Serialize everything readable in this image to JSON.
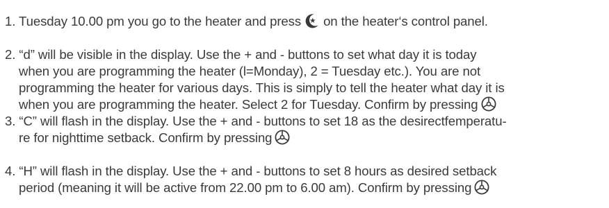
{
  "steps": [
    {
      "number": "1.",
      "lines": [
        {
          "before": "Tuesday 10.00 pm you go to the heater and press",
          "after": "on the heater‘s control panel."
        }
      ],
      "icon": "moon-star-icon"
    },
    {
      "number": "2.",
      "lines": [
        "“d” will be visible in the display. Use the + and - buttons to set what day it is today",
        "when you are programming the heater (l=Monday), 2 = Tuesday etc.). You are not",
        "programming the heater for various days. This is simply to tell the heater what day it is",
        "when you are programming the heater. Select 2 for Tuesday. Confirm by pressing"
      ],
      "icon": "confirm-wheel-icon"
    },
    {
      "number": "3.",
      "lines": [
        "“C” will flash in the display. Use the + and - buttons to set 18 as the desirectfemperatu-",
        "re for nighttime setback. Confirm by pressing"
      ],
      "icon": "confirm-wheel-icon"
    },
    {
      "number": "4.",
      "lines": [
        "“H” will flash in the display. Use the + and - buttons to set 8 hours as desired setback",
        "period (meaning it will be active from 22.00 pm to 6.00 am). Confirm by pressing"
      ],
      "icon": "confirm-wheel-icon"
    }
  ],
  "colors": {
    "text": "#3a3a3a",
    "icon": "#3a3a3a"
  }
}
